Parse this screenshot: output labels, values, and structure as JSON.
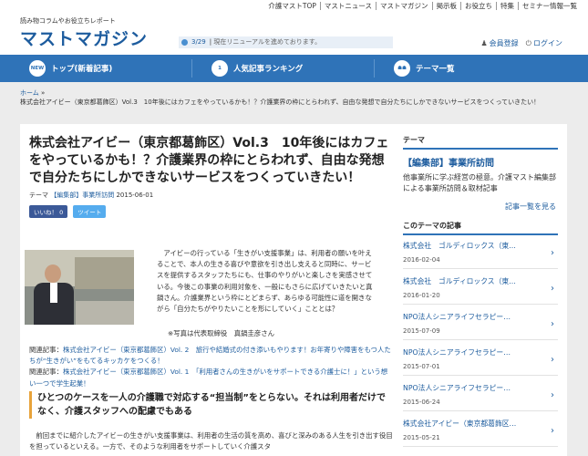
{
  "top_nav": [
    "介護マストTOP",
    "マストニュース",
    "マストマガジン",
    "掲示板",
    "お役立ち",
    "特集",
    "セミナー情報一覧"
  ],
  "header": {
    "tagline": "読み物コラムやお役立ちレポート",
    "logo": "マストマガジン",
    "notice_date": "3/29",
    "notice_text": "現在リニューアルを進めております。",
    "register": "会員登録",
    "login": "ログイン"
  },
  "main_nav": {
    "items": [
      {
        "icon": "NEW",
        "label": "トップ(新着記事)"
      },
      {
        "icon": "1",
        "label": "人気記事ランキング"
      },
      {
        "icon": "☗☗",
        "label": "テーマ一覧"
      }
    ]
  },
  "breadcrumb": {
    "home": "ホーム",
    "current": "株式会社アイビー（東京都葛飾区）Vol.3　10年後にはカフェをやっているかも！？介護業界の枠にとらわれず、自由な発想で自分たちにしかできないサービスをつくっていきたい！"
  },
  "article": {
    "title": "株式会社アイビー（東京都葛飾区）Vol.3　10年後にはカフェをやっているかも！？介護業界の枠にとらわれず、自由な発想で自分たちにしかできないサービスをつくっていきたい！",
    "theme_label": "テーマ",
    "theme": "【編集部】事業所訪問",
    "date": "2015-06-01",
    "like": "いいね！ 0",
    "tweet": "ツイート",
    "body": "アイビーの行っている「生きがい支援事業」は、利用者の願いを叶えることで、本人の生きる喜びや意欲を引き出し支えると同時に、サービスを提供するスタッフたちにも、仕事のやりがいと楽しさを実感させている。今後この事業の利用対象を、一般にもさらに広げていきたいと真鍋さん。介護業界という枠にとどまらず、あらゆる可能性に道を開きながら「自分たちがやりたいことを形にしていく」こととは？",
    "caption": "※写真は代表取締役　真鍋圭彦さん",
    "related_label": "関連記事：",
    "related": [
      "株式会社アイビー（東京都葛飾区）Vol. 2　旅行や結婚式の付き添いもやります！お年寄りや障害をもつ人たちが“生きがい”をもてるキッカケをつくる！",
      "株式会社アイビー（東京都葛飾区）Vol. 1　「利用者さんの生きがいをサポートできる介護士に！」という想い一つで学生起業！"
    ],
    "subhead": "ひとつのケースを一人の介護職で対応する“担当制”をとらない。それは利用者だけでなく、介護スタッフへの配慮でもある",
    "para2": "前回までに紹介したアイビーの生きがい支援事業は、利用者の生活の質を高め、喜びと深みのある人生を引き出す役目を担っているといえる。一方で、そのような利用者をサポートしていく介護スタ"
  },
  "sidebar": {
    "theme_heading": "テーマ",
    "theme_title": "【編集部】事業所訪問",
    "theme_desc": "他事業所に学ぶ経営の極意。介護マスト編集部による事業所訪問＆取材記事",
    "more": "記事一覧を見る",
    "list_heading": "このテーマの記事",
    "items": [
      {
        "title": "株式会社　ゴルディロックス（東…",
        "date": "2016-02-04"
      },
      {
        "title": "株式会社　ゴルディロックス（東…",
        "date": "2016-01-20"
      },
      {
        "title": "NPO法人シニアライフセラピー…",
        "date": "2015-07-09"
      },
      {
        "title": "NPO法人シニアライフセラピー…",
        "date": "2015-07-01"
      },
      {
        "title": "NPO法人シニアライフセラピー…",
        "date": "2015-06-24"
      },
      {
        "title": "株式会社アイビー（東京都葛飾区…",
        "date": "2015-05-21"
      }
    ]
  }
}
